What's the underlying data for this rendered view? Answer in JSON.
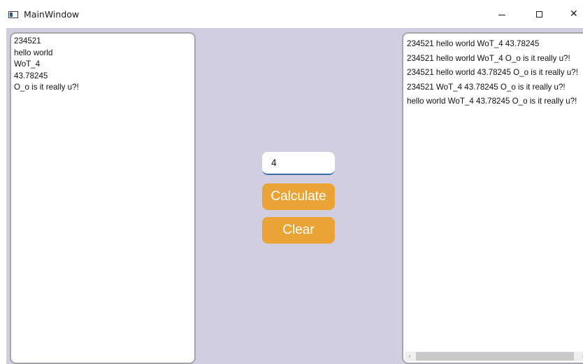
{
  "window": {
    "title": "MainWindow",
    "minimize_glyph": "",
    "maximize_glyph": "",
    "close_glyph": "✕"
  },
  "input_list": {
    "items": [
      "234521",
      "hello world",
      "WoT_4",
      "43.78245",
      "O_o is it really u?!"
    ]
  },
  "controls": {
    "number_value": "4",
    "calculate_label": "Calculate",
    "clear_label": "Clear",
    "accent_color": "#eaa335",
    "background_color": "#d2cee2"
  },
  "output_list": {
    "items": [
      "234521 hello world WoT_4 43.78245",
      "234521 hello world WoT_4 O_o is it really u?!",
      "234521 hello world 43.78245 O_o is it really u?!",
      "234521 WoT_4 43.78245 O_o is it really u?!",
      "hello world WoT_4 43.78245 O_o is it really u?!"
    ],
    "scroll_left_glyph": "‹",
    "scroll_right_glyph": "›"
  }
}
